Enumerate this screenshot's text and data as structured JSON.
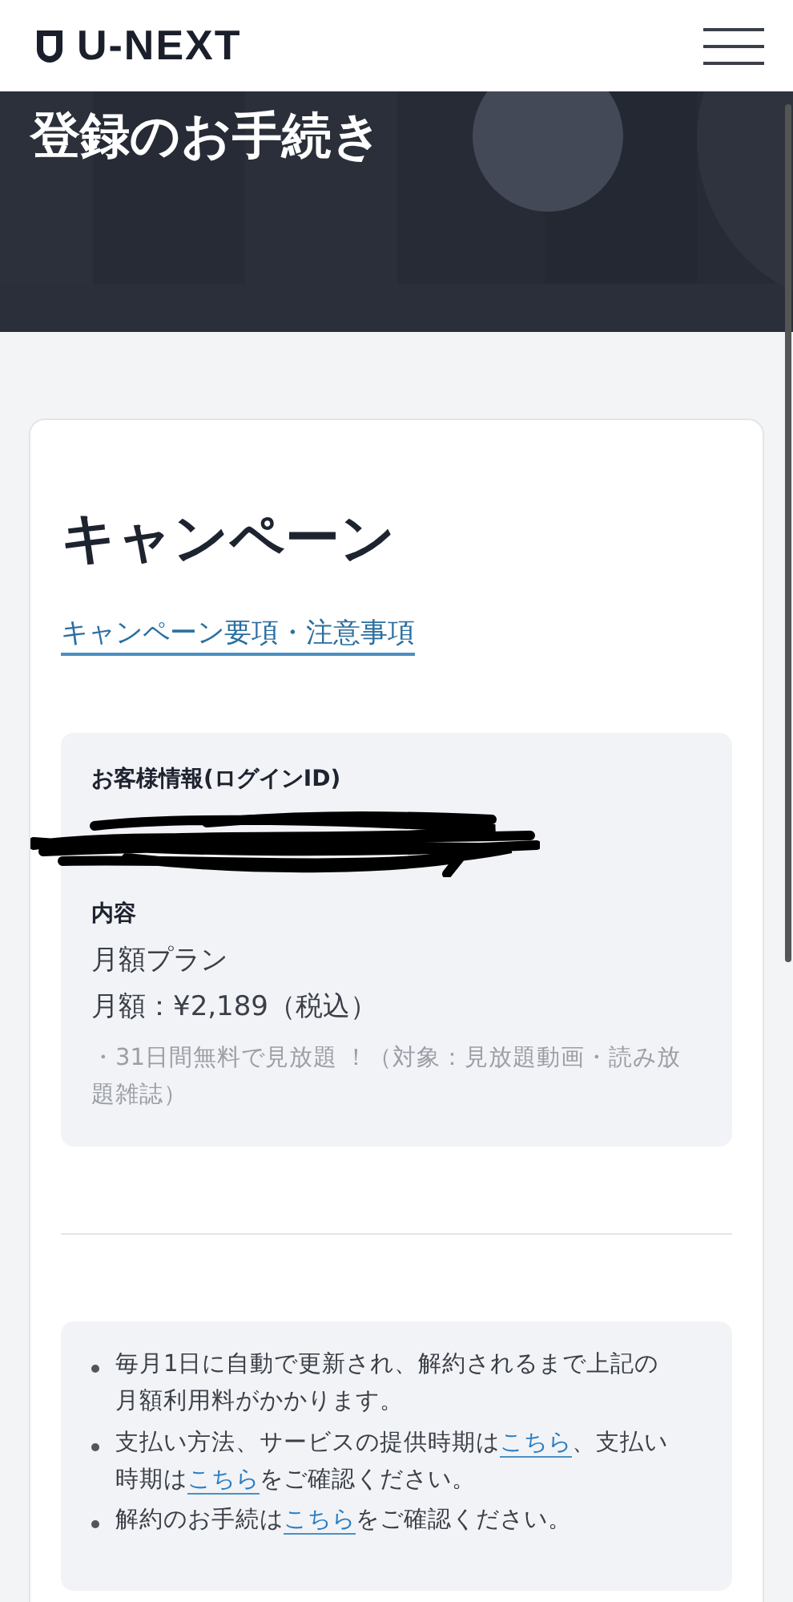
{
  "header": {
    "logo": "U-NEXT"
  },
  "hero": {
    "title": "登録のお手続き"
  },
  "campaign": {
    "heading": "キャンペーン",
    "link": "キャンペーン要項・注意事項"
  },
  "info": {
    "customer_label": "お客様情報(ログインID)",
    "content_label": "内容",
    "plan": "月額プラン",
    "price": "月額：¥2,189（税込）",
    "note": "・31日間無料で見放題 ！（対象：見放題動画・読み放題雑誌）"
  },
  "notes": [
    [
      {
        "text": "毎月1日に自動で更新され、解約されるまで上記の月額利用料がかかります。",
        "link": false
      }
    ],
    [
      {
        "text": "支払い方法、サービスの提供時期は",
        "link": false
      },
      {
        "text": "こちら",
        "link": true
      },
      {
        "text": "、支払い時期は",
        "link": false
      },
      {
        "text": "こちら",
        "link": true
      },
      {
        "text": "をご確認ください。",
        "link": false
      }
    ],
    [
      {
        "text": "解約のお手続は",
        "link": false
      },
      {
        "text": "こちら",
        "link": true
      },
      {
        "text": "をご確認ください。",
        "link": false
      }
    ]
  ]
}
